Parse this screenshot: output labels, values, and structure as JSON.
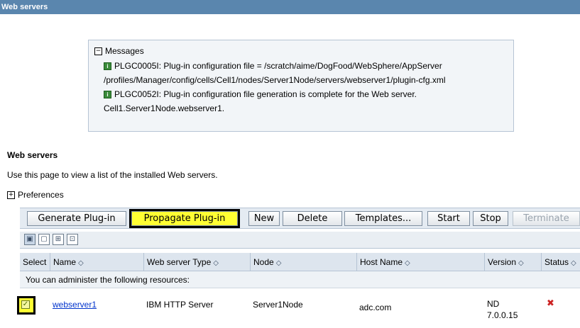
{
  "window": {
    "title": "Web servers"
  },
  "messages": {
    "heading": "Messages",
    "lines": [
      "PLGC0005I: Plug-in configuration file = /scratch/aime/DogFood/WebSphere/AppServer",
      "/profiles/Manager/config/cells/Cell1/nodes/Server1Node/servers/webserver1/plugin-cfg.xml",
      "PLGC0052I: Plug-in configuration file generation is complete for the Web server.",
      "Cell1.Server1Node.webserver1."
    ]
  },
  "section": {
    "title": "Web servers",
    "description": "Use this page to view a list of the installed Web servers.",
    "preferences": "Preferences"
  },
  "toolbar": {
    "buttons": [
      "Generate Plug-in",
      "Propagate Plug-in",
      "New",
      "Delete",
      "Templates...",
      "Start",
      "Stop",
      "Terminate"
    ]
  },
  "table": {
    "headers": [
      "Select",
      "Name",
      "Web server Type",
      "Node",
      "Host Name",
      "Version",
      "Status"
    ],
    "admin_text": "You can administer the following resources:",
    "rows": [
      {
        "name": "webserver1",
        "type": "IBM HTTP Server",
        "node": "Server1Node",
        "host": "adc.com",
        "version_line1": "ND",
        "version_line2": "7.0.0.15"
      }
    ]
  },
  "colors": {
    "title_bar": "#5a86ae",
    "highlight": "#ffff33",
    "link": "#0033cc",
    "status_stopped": "#cc2222"
  }
}
